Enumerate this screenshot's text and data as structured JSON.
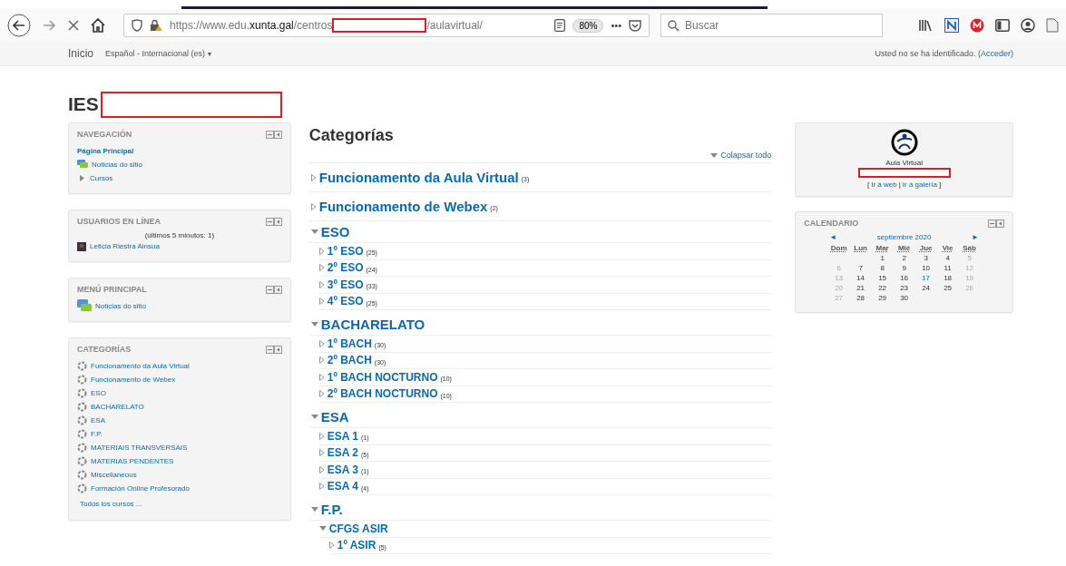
{
  "browser": {
    "url_prefix": "https://www.edu.",
    "url_domain": "xunta.gal",
    "url_mid": "/centros",
    "url_suffix": "/aulavirtual/",
    "zoom": "80%",
    "menu_dots": "•••",
    "search_placeholder": "Buscar"
  },
  "navbar": {
    "home": "Inicio",
    "language": "Español - Internacional (es)",
    "language_caret": "▾",
    "login_text": "Usted no se ha identificado. (",
    "login_link": "Acceder",
    "login_end": ")"
  },
  "site_title": "IES",
  "blocks": [
    {
      "title": "NAVEGACIÓN",
      "items": [
        {
          "label": "Página Principal",
          "kind": "home"
        },
        {
          "label": "Noticias do sitio",
          "kind": "forum"
        },
        {
          "label": "Cursos",
          "kind": "branch"
        }
      ]
    },
    {
      "title": "USUARIOS EN LÍNEA",
      "note": "(últimos 5 minutos: 1)",
      "items": [
        {
          "label": "Leticia Riestra Ainsua",
          "kind": "user"
        }
      ]
    },
    {
      "title": "MENÚ PRINCIPAL",
      "items": [
        {
          "label": "Noticias do sitio",
          "kind": "forum-large"
        }
      ]
    },
    {
      "title": "CATEGORÍAS",
      "items": [
        {
          "label": "Funcionamento da Aula Virtual",
          "kind": "category"
        },
        {
          "label": "Funcionamento de Webex",
          "kind": "category"
        },
        {
          "label": "ESO",
          "kind": "category"
        },
        {
          "label": "BACHARELATO",
          "kind": "category"
        },
        {
          "label": "ESA",
          "kind": "category"
        },
        {
          "label": "F.P.",
          "kind": "category"
        },
        {
          "label": "MATERIAIS TRANSVERSAIS",
          "kind": "category"
        },
        {
          "label": "MATERIAS PENDENTES",
          "kind": "category"
        },
        {
          "label": "Miscellaneous",
          "kind": "category"
        },
        {
          "label": "Formación Online Profesorado",
          "kind": "category"
        }
      ],
      "footer": "Todos los cursos ..."
    }
  ],
  "main": {
    "title": "Categorías",
    "collapse_all": "Colapsar todo",
    "categories": [
      {
        "name": "Funcionamento da Aula Virtual",
        "count": "(3)",
        "expanded": false
      },
      {
        "name": "Funcionamento de Webex",
        "count": "(2)",
        "expanded": false
      },
      {
        "name": "ESO",
        "expanded": true,
        "children": [
          {
            "name": "1º ESO",
            "count": "(25)",
            "expanded": false
          },
          {
            "name": "2º ESO",
            "count": "(24)",
            "expanded": false
          },
          {
            "name": "3º ESO",
            "count": "(33)",
            "expanded": false
          },
          {
            "name": "4º ESO",
            "count": "(25)",
            "expanded": false
          }
        ]
      },
      {
        "name": "BACHARELATO",
        "expanded": true,
        "children": [
          {
            "name": "1º BACH",
            "count": "(30)",
            "expanded": false
          },
          {
            "name": "2º BACH",
            "count": "(30)",
            "expanded": false
          },
          {
            "name": "1º BACH NOCTURNO",
            "count": "(10)",
            "expanded": false
          },
          {
            "name": "2º BACH NOCTURNO",
            "count": "(10)",
            "expanded": false
          }
        ]
      },
      {
        "name": "ESA",
        "expanded": true,
        "children": [
          {
            "name": "ESA 1",
            "count": "(1)",
            "expanded": false
          },
          {
            "name": "ESA 2",
            "count": "(5)",
            "expanded": false
          },
          {
            "name": "ESA 3",
            "count": "(1)",
            "expanded": false
          },
          {
            "name": "ESA 4",
            "count": "(4)",
            "expanded": false
          }
        ]
      },
      {
        "name": "F.P.",
        "expanded": true,
        "children": [
          {
            "name": "CFGS ASIR",
            "expanded": true,
            "children": [
              {
                "name": "1º ASIR",
                "count": "(5)",
                "expanded": false
              }
            ]
          }
        ]
      }
    ]
  },
  "logo_block": {
    "caption": "Aula Virtual",
    "link_open": "[",
    "link_web": "Ir á web",
    "separator": "|",
    "link_gallery": "Ir á galería",
    "link_close": "]"
  },
  "calendar": {
    "title": "CALENDARIO",
    "prev": "◄",
    "month": "septiembre 2020",
    "next": "►",
    "weekdays": [
      "Dom",
      "Lun",
      "Mar",
      "Mié",
      "Jue",
      "Vie",
      "Sáb"
    ],
    "weeks": [
      [
        {
          "kind": "blank"
        },
        {
          "kind": "blank"
        },
        {
          "day": "1",
          "kind": "weekday"
        },
        {
          "day": "2",
          "kind": "weekday"
        },
        {
          "day": "3",
          "kind": "weekday"
        },
        {
          "day": "4",
          "kind": "weekday"
        },
        {
          "day": "5",
          "kind": "weekend"
        }
      ],
      [
        {
          "day": "6",
          "kind": "weekend"
        },
        {
          "day": "7",
          "kind": "weekday"
        },
        {
          "day": "8",
          "kind": "weekday"
        },
        {
          "day": "9",
          "kind": "weekday"
        },
        {
          "day": "10",
          "kind": "weekday"
        },
        {
          "day": "11",
          "kind": "weekday"
        },
        {
          "day": "12",
          "kind": "weekend"
        }
      ],
      [
        {
          "day": "13",
          "kind": "weekend"
        },
        {
          "day": "14",
          "kind": "weekday"
        },
        {
          "day": "15",
          "kind": "weekday"
        },
        {
          "day": "16",
          "kind": "weekday"
        },
        {
          "day": "17",
          "kind": "today"
        },
        {
          "day": "18",
          "kind": "weekday"
        },
        {
          "day": "19",
          "kind": "weekend"
        }
      ],
      [
        {
          "day": "20",
          "kind": "weekend"
        },
        {
          "day": "21",
          "kind": "weekday"
        },
        {
          "day": "22",
          "kind": "weekday"
        },
        {
          "day": "23",
          "kind": "weekday"
        },
        {
          "day": "24",
          "kind": "weekday"
        },
        {
          "day": "25",
          "kind": "weekday"
        },
        {
          "day": "26",
          "kind": "weekend"
        }
      ],
      [
        {
          "day": "27",
          "kind": "weekend"
        },
        {
          "day": "28",
          "kind": "weekday"
        },
        {
          "day": "29",
          "kind": "weekday"
        },
        {
          "day": "30",
          "kind": "weekday"
        },
        {
          "kind": "blank"
        },
        {
          "kind": "blank"
        },
        {
          "kind": "blank"
        }
      ]
    ]
  }
}
